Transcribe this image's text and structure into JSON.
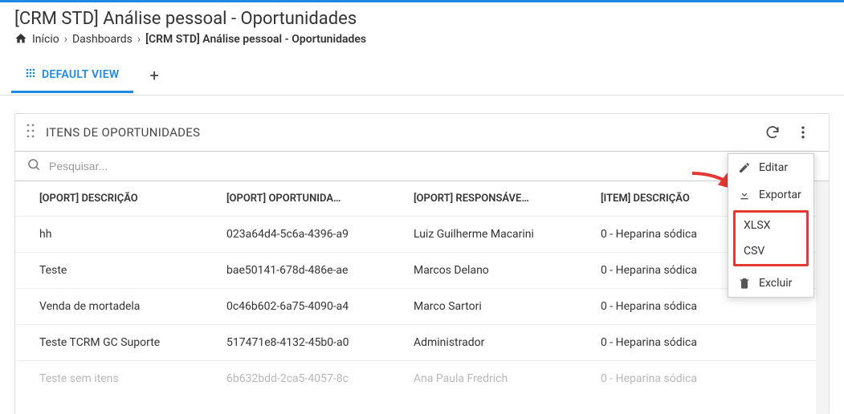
{
  "page_title": "[CRM STD] Análise pessoal - Oportunidades",
  "breadcrumb": {
    "home": "Início",
    "level1": "Dashboards",
    "current": "[CRM STD] Análise pessoal - Oportunidades"
  },
  "tabs": {
    "default": "DEFAULT VIEW"
  },
  "card": {
    "title": "ITENS DE OPORTUNIDADES",
    "search_placeholder": "Pesquisar..."
  },
  "columns": {
    "c1": "[OPORT] DESCRIÇÃO",
    "c2": "[OPORT] OPORTUNIDA…",
    "c3": "[OPORT] RESPONSÁVE…",
    "c4": "[ITEM] DESCRIÇÃO"
  },
  "rows": [
    {
      "c1": "hh",
      "c2": "023a64d4-5c6a-4396-a9",
      "c3": "Luiz Guilherme Macarini",
      "c4": "0 - Heparina sódica"
    },
    {
      "c1": "Teste",
      "c2": "bae50141-678d-486e-ae",
      "c3": "Marcos Delano",
      "c4": "0 - Heparina sódica"
    },
    {
      "c1": "Venda de mortadela",
      "c2": "0c46b602-6a75-4090-a4",
      "c3": "Marco Sartori",
      "c4": "0 - Heparina sódica"
    },
    {
      "c1": "Teste TCRM GC Suporte",
      "c2": "517471e8-4132-45b0-a0",
      "c3": "Administrador",
      "c4": "0 - Heparina sódica"
    },
    {
      "c1": "Teste sem itens",
      "c2": "6b632bdd-2ca5-4057-8c",
      "c3": "Ana Paula Fredrich",
      "c4": "0 - Heparina sódica"
    }
  ],
  "menu": {
    "edit": "Editar",
    "export": "Exportar",
    "xlsx": "XLSX",
    "csv": "CSV",
    "delete": "Excluir"
  }
}
